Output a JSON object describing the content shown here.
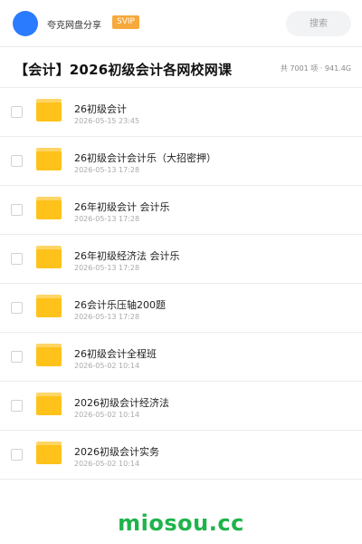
{
  "header": {
    "brand": "夸克网盘分享",
    "badge": "SVIP",
    "search_placeholder": "搜索"
  },
  "page": {
    "title": "【会计】2026初级会计各网校网课",
    "meta": "共 7001 项 · 941.4G"
  },
  "items": [
    {
      "name": "26初级会计",
      "date": "2026-05-15 23:45"
    },
    {
      "name": "26初级会计会计乐（大招密押）",
      "date": "2026-05-13 17:28"
    },
    {
      "name": "26年初级会计  会计乐",
      "date": "2026-05-13 17:28"
    },
    {
      "name": "26年初级经济法  会计乐",
      "date": "2026-05-13 17:28"
    },
    {
      "name": "26会计乐压轴200题",
      "date": "2026-05-13 17:28"
    },
    {
      "name": "26初级会计全程班",
      "date": "2026-05-02 10:14"
    },
    {
      "name": "2026初级会计经济法",
      "date": "2026-05-02 10:14"
    },
    {
      "name": "2026初级会计实务",
      "date": "2026-05-02 10:14"
    }
  ],
  "watermark": "miosou.cc",
  "colors": {
    "accent": "#2b7bff",
    "badge": "#f7a93b",
    "folder": "#ffc21a",
    "watermark": "#1fb34b"
  }
}
